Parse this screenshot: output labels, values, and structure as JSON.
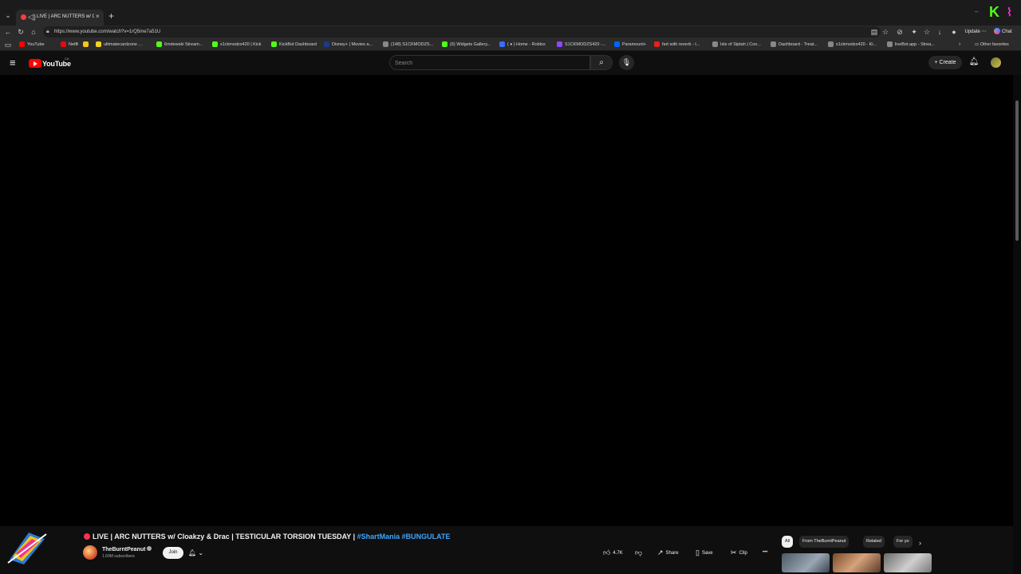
{
  "browser": {
    "tab_title": "LIVE | ARC NUTTERS w/ Cl",
    "url": "https://www.youtube.com/watch?v=1rQ5me7a51U",
    "update_label": "Update",
    "chat_label": "Chat",
    "tab_close": "×",
    "new_tab": "+",
    "minimize": "–",
    "kick_letter": "K",
    "bookmarks": [
      {
        "label": "YouTube",
        "color": "#ff0000"
      },
      {
        "label": "Netflix",
        "color": "#e50914"
      },
      {
        "label": "",
        "color": "#f5c518"
      },
      {
        "label": "ultimatecardzone ...",
        "color": "#f2d21b"
      },
      {
        "label": "6mdewski Stream...",
        "color": "#53fc18"
      },
      {
        "label": "s1ckmodzs420 | Kick",
        "color": "#53fc18"
      },
      {
        "label": "KickBot Dashboard",
        "color": "#53fc18"
      },
      {
        "label": "Disney+ | Movies a...",
        "color": "#1b3a8a"
      },
      {
        "label": "(148) S1CKMODZS...",
        "color": "#888888"
      },
      {
        "label": "(6) Widgets Gallery...",
        "color": "#53fc18"
      },
      {
        "label": "( ♦ ) Home - Roblox",
        "color": "#3a6dff"
      },
      {
        "label": "S1CKMODZS420 -...",
        "color": "#9146ff"
      },
      {
        "label": "Paramount+",
        "color": "#0064ff"
      },
      {
        "label": "fart with reverb - I...",
        "color": "#e62117"
      },
      {
        "label": "Isle of Siptah | Con...",
        "color": "#888888"
      },
      {
        "label": "Dashboard - Treat...",
        "color": "#888888"
      },
      {
        "label": "s1ckmodzs420 - Ki...",
        "color": "#888888"
      },
      {
        "label": "liveBot.app - Strea...",
        "color": "#888888"
      }
    ],
    "other_favorites": "Other favorites"
  },
  "youtube": {
    "logo_text": "YouTube",
    "country": "CA",
    "search_placeholder": "Search",
    "create_label": "Create"
  },
  "video": {
    "title_main": "LIVE | ARC NUTTERS w/ Cloakzy & Drac | TESTICULAR TORSION TUESDAY |",
    "hashtag1": "#ShartMania",
    "hashtag2": "#BUNGULATE",
    "channel": "TheBurntPeanut",
    "subscribers": "1.69M subscribers",
    "join_label": "Join",
    "likes": "4.7K",
    "share_label": "Share",
    "save_label": "Save",
    "clip_label": "Clip",
    "more_label": "•••"
  },
  "chips": {
    "all": "All",
    "from_channel": "From TheBurntPeanut",
    "related": "Related",
    "for_you": "For yo"
  },
  "colors": {
    "accent": "#ff0000",
    "kick_green": "#53fc18",
    "link_blue": "#3ea6ff"
  }
}
